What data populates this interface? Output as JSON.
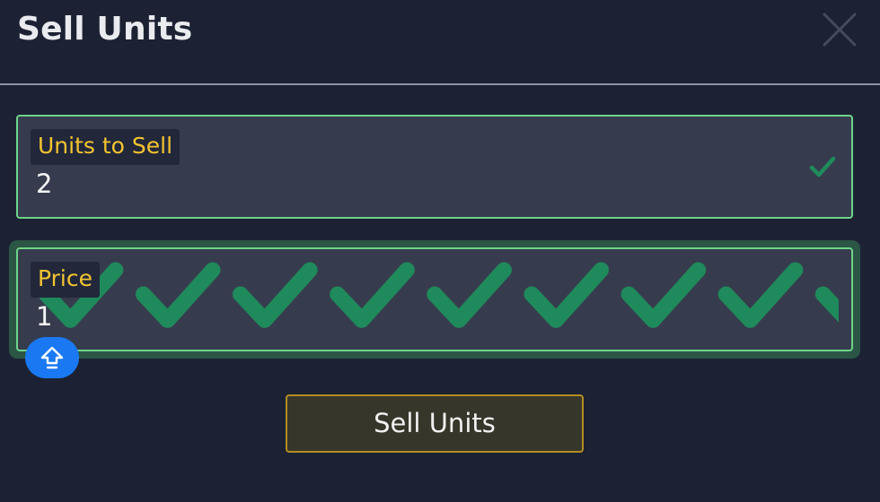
{
  "modal": {
    "title": "Sell Units",
    "close_icon": "close-icon"
  },
  "fields": {
    "units": {
      "label": "Units to Sell",
      "value": "2",
      "status_icon": "checkmark-icon"
    },
    "price": {
      "label": "Price",
      "value": "1",
      "background_pattern": "checkmark-icon"
    }
  },
  "keyboard_toggle": {
    "icon": "shift-arrow-icon"
  },
  "submit": {
    "label": "Sell Units"
  },
  "colors": {
    "background": "#1c2233",
    "field_background": "#363c4d",
    "valid_border": "#6fd388",
    "label_text": "#f4c430",
    "check_green": "#1f8a5b",
    "keyboard_button": "#1a78f2",
    "submit_border": "#b38d22"
  }
}
